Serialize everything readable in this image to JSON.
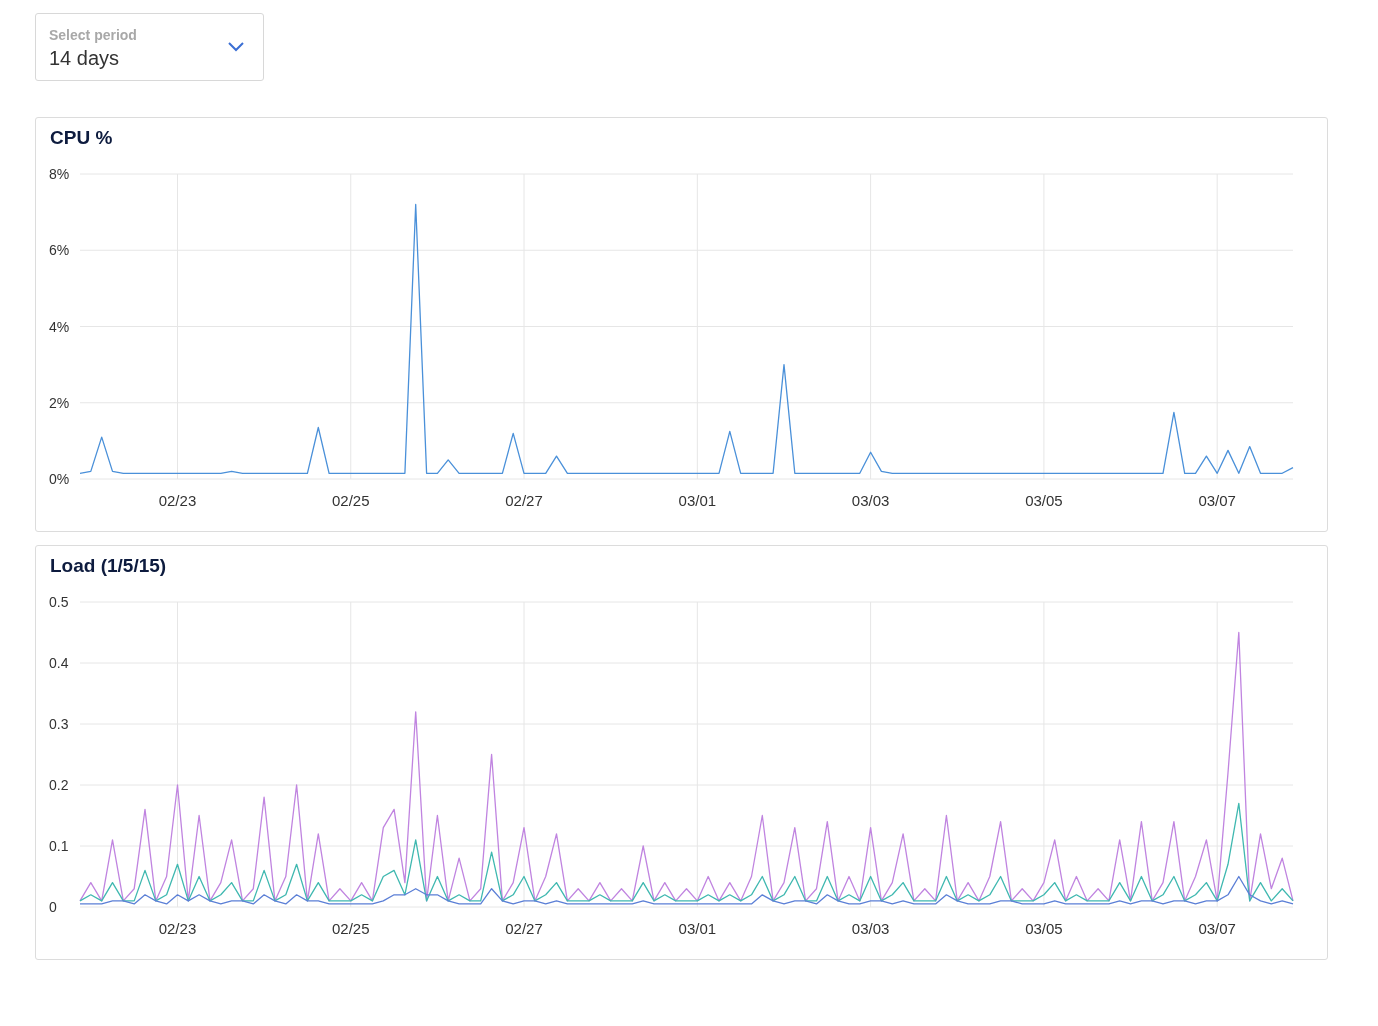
{
  "period_select": {
    "label": "Select period",
    "value": "14 days"
  },
  "charts": [
    {
      "title": "CPU %",
      "chart_data": {
        "type": "line",
        "grid": true,
        "ylim": [
          0,
          8
        ],
        "yticks": [
          {
            "value": 0,
            "label": "0%"
          },
          {
            "value": 2,
            "label": "2%"
          },
          {
            "value": 4,
            "label": "4%"
          },
          {
            "value": 6,
            "label": "6%"
          },
          {
            "value": 8,
            "label": "8%"
          }
        ],
        "categories": [
          null,
          null,
          null,
          null,
          null,
          null,
          null,
          null,
          null,
          "02/23",
          null,
          null,
          null,
          null,
          null,
          null,
          null,
          null,
          null,
          null,
          null,
          null,
          null,
          null,
          null,
          "02/25",
          null,
          null,
          null,
          null,
          null,
          null,
          null,
          null,
          null,
          null,
          null,
          null,
          null,
          null,
          null,
          "02/27",
          null,
          null,
          null,
          null,
          null,
          null,
          null,
          null,
          null,
          null,
          null,
          null,
          null,
          null,
          null,
          "03/01",
          null,
          null,
          null,
          null,
          null,
          null,
          null,
          null,
          null,
          null,
          null,
          null,
          null,
          null,
          null,
          "03/03",
          null,
          null,
          null,
          null,
          null,
          null,
          null,
          null,
          null,
          null,
          null,
          null,
          null,
          null,
          null,
          "03/05",
          null,
          null,
          null,
          null,
          null,
          null,
          null,
          null,
          null,
          null,
          null,
          null,
          null,
          null,
          null,
          "03/07",
          null,
          null,
          null,
          null,
          null,
          null,
          null
        ],
        "series": [
          {
            "color": "#4a90d9",
            "values": [
              0.15,
              0.2,
              1.1,
              0.2,
              0.15,
              0.15,
              0.15,
              0.15,
              0.15,
              0.15,
              0.15,
              0.15,
              0.15,
              0.15,
              0.2,
              0.15,
              0.15,
              0.15,
              0.15,
              0.15,
              0.15,
              0.15,
              1.35,
              0.15,
              0.15,
              0.15,
              0.15,
              0.15,
              0.15,
              0.15,
              0.15,
              7.2,
              0.15,
              0.15,
              0.5,
              0.15,
              0.15,
              0.15,
              0.15,
              0.15,
              1.2,
              0.15,
              0.15,
              0.15,
              0.6,
              0.15,
              0.15,
              0.15,
              0.15,
              0.15,
              0.15,
              0.15,
              0.15,
              0.15,
              0.15,
              0.15,
              0.15,
              0.15,
              0.15,
              0.15,
              1.25,
              0.15,
              0.15,
              0.15,
              0.15,
              3.0,
              0.15,
              0.15,
              0.15,
              0.15,
              0.15,
              0.15,
              0.15,
              0.7,
              0.2,
              0.15,
              0.15,
              0.15,
              0.15,
              0.15,
              0.15,
              0.15,
              0.15,
              0.15,
              0.15,
              0.15,
              0.15,
              0.15,
              0.15,
              0.15,
              0.15,
              0.15,
              0.15,
              0.15,
              0.15,
              0.15,
              0.15,
              0.15,
              0.15,
              0.15,
              0.15,
              1.75,
              0.15,
              0.15,
              0.6,
              0.15,
              0.75,
              0.15,
              0.85,
              0.15,
              0.15,
              0.15,
              0.3
            ]
          }
        ]
      }
    },
    {
      "title": "Load (1/5/15)",
      "chart_data": {
        "type": "line",
        "grid": true,
        "ylim": [
          0,
          0.5
        ],
        "yticks": [
          {
            "value": 0,
            "label": "0"
          },
          {
            "value": 0.1,
            "label": "0.1"
          },
          {
            "value": 0.2,
            "label": "0.2"
          },
          {
            "value": 0.3,
            "label": "0.3"
          },
          {
            "value": 0.4,
            "label": "0.4"
          },
          {
            "value": 0.5,
            "label": "0.5"
          }
        ],
        "categories": [
          null,
          null,
          null,
          null,
          null,
          null,
          null,
          null,
          null,
          "02/23",
          null,
          null,
          null,
          null,
          null,
          null,
          null,
          null,
          null,
          null,
          null,
          null,
          null,
          null,
          null,
          "02/25",
          null,
          null,
          null,
          null,
          null,
          null,
          null,
          null,
          null,
          null,
          null,
          null,
          null,
          null,
          null,
          "02/27",
          null,
          null,
          null,
          null,
          null,
          null,
          null,
          null,
          null,
          null,
          null,
          null,
          null,
          null,
          null,
          "03/01",
          null,
          null,
          null,
          null,
          null,
          null,
          null,
          null,
          null,
          null,
          null,
          null,
          null,
          null,
          null,
          "03/03",
          null,
          null,
          null,
          null,
          null,
          null,
          null,
          null,
          null,
          null,
          null,
          null,
          null,
          null,
          null,
          "03/05",
          null,
          null,
          null,
          null,
          null,
          null,
          null,
          null,
          null,
          null,
          null,
          null,
          null,
          null,
          null,
          "03/07",
          null,
          null,
          null,
          null,
          null,
          null,
          null
        ],
        "series": [
          {
            "color": "#c084e0",
            "values": [
              0.01,
              0.04,
              0.01,
              0.11,
              0.01,
              0.03,
              0.16,
              0.01,
              0.05,
              0.2,
              0.01,
              0.15,
              0.01,
              0.04,
              0.11,
              0.01,
              0.03,
              0.18,
              0.01,
              0.05,
              0.2,
              0.01,
              0.12,
              0.01,
              0.03,
              0.01,
              0.04,
              0.01,
              0.13,
              0.16,
              0.04,
              0.32,
              0.01,
              0.15,
              0.01,
              0.08,
              0.01,
              0.03,
              0.25,
              0.01,
              0.04,
              0.13,
              0.01,
              0.05,
              0.12,
              0.01,
              0.03,
              0.01,
              0.04,
              0.01,
              0.03,
              0.01,
              0.1,
              0.01,
              0.04,
              0.01,
              0.03,
              0.01,
              0.05,
              0.01,
              0.04,
              0.01,
              0.05,
              0.15,
              0.01,
              0.04,
              0.13,
              0.01,
              0.03,
              0.14,
              0.01,
              0.05,
              0.01,
              0.13,
              0.01,
              0.04,
              0.12,
              0.01,
              0.03,
              0.01,
              0.15,
              0.01,
              0.04,
              0.01,
              0.05,
              0.14,
              0.01,
              0.03,
              0.01,
              0.04,
              0.11,
              0.01,
              0.05,
              0.01,
              0.03,
              0.01,
              0.11,
              0.01,
              0.14,
              0.01,
              0.04,
              0.14,
              0.01,
              0.05,
              0.11,
              0.01,
              0.22,
              0.45,
              0.01,
              0.12,
              0.03,
              0.08,
              0.01
            ]
          },
          {
            "color": "#3fb8b0",
            "values": [
              0.01,
              0.02,
              0.01,
              0.04,
              0.01,
              0.01,
              0.06,
              0.01,
              0.02,
              0.07,
              0.01,
              0.05,
              0.01,
              0.02,
              0.04,
              0.01,
              0.01,
              0.06,
              0.01,
              0.02,
              0.07,
              0.01,
              0.04,
              0.01,
              0.01,
              0.01,
              0.02,
              0.01,
              0.05,
              0.06,
              0.02,
              0.11,
              0.01,
              0.05,
              0.01,
              0.02,
              0.01,
              0.01,
              0.09,
              0.01,
              0.02,
              0.05,
              0.01,
              0.02,
              0.04,
              0.01,
              0.01,
              0.01,
              0.02,
              0.01,
              0.01,
              0.01,
              0.04,
              0.01,
              0.02,
              0.01,
              0.01,
              0.01,
              0.02,
              0.01,
              0.02,
              0.01,
              0.02,
              0.05,
              0.01,
              0.02,
              0.05,
              0.01,
              0.01,
              0.05,
              0.01,
              0.02,
              0.01,
              0.05,
              0.01,
              0.02,
              0.04,
              0.01,
              0.01,
              0.01,
              0.05,
              0.01,
              0.02,
              0.01,
              0.02,
              0.05,
              0.01,
              0.01,
              0.01,
              0.02,
              0.04,
              0.01,
              0.02,
              0.01,
              0.01,
              0.01,
              0.04,
              0.01,
              0.05,
              0.01,
              0.02,
              0.05,
              0.01,
              0.02,
              0.04,
              0.01,
              0.07,
              0.17,
              0.01,
              0.04,
              0.01,
              0.03,
              0.01
            ]
          },
          {
            "color": "#5b7fd6",
            "values": [
              0.005,
              0.005,
              0.005,
              0.01,
              0.01,
              0.005,
              0.02,
              0.01,
              0.005,
              0.02,
              0.01,
              0.02,
              0.01,
              0.005,
              0.01,
              0.01,
              0.005,
              0.02,
              0.01,
              0.005,
              0.02,
              0.01,
              0.01,
              0.005,
              0.005,
              0.005,
              0.005,
              0.005,
              0.01,
              0.02,
              0.02,
              0.03,
              0.02,
              0.02,
              0.01,
              0.005,
              0.005,
              0.005,
              0.03,
              0.01,
              0.005,
              0.01,
              0.01,
              0.005,
              0.01,
              0.005,
              0.005,
              0.005,
              0.005,
              0.005,
              0.005,
              0.005,
              0.01,
              0.005,
              0.005,
              0.005,
              0.005,
              0.005,
              0.005,
              0.005,
              0.005,
              0.005,
              0.005,
              0.02,
              0.01,
              0.005,
              0.01,
              0.01,
              0.005,
              0.02,
              0.01,
              0.005,
              0.005,
              0.01,
              0.01,
              0.005,
              0.01,
              0.005,
              0.005,
              0.005,
              0.02,
              0.01,
              0.005,
              0.005,
              0.005,
              0.01,
              0.01,
              0.005,
              0.005,
              0.005,
              0.01,
              0.005,
              0.005,
              0.005,
              0.005,
              0.005,
              0.01,
              0.005,
              0.01,
              0.01,
              0.005,
              0.01,
              0.01,
              0.005,
              0.01,
              0.01,
              0.02,
              0.05,
              0.02,
              0.01,
              0.005,
              0.01,
              0.005
            ]
          }
        ]
      }
    }
  ]
}
